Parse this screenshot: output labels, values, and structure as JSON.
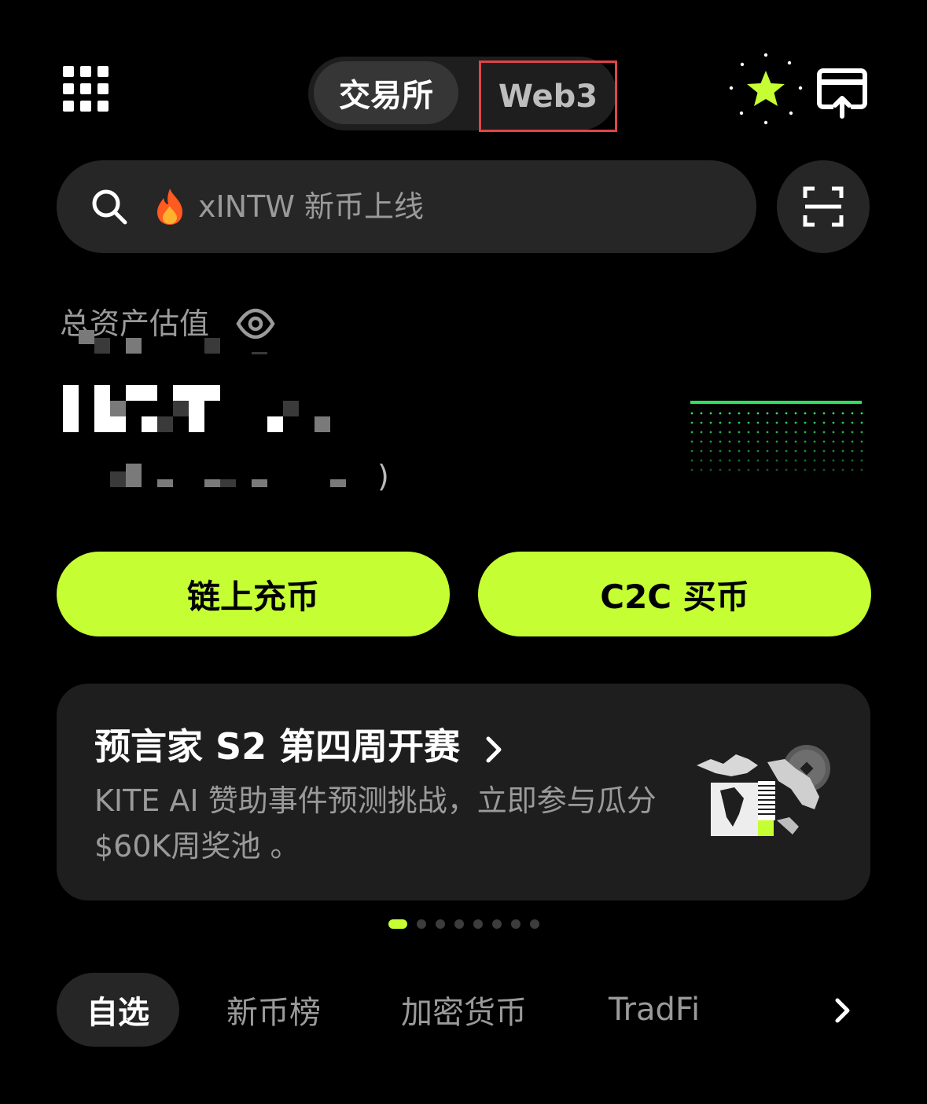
{
  "top_bar": {
    "mode_tabs": [
      {
        "label": "交易所",
        "active": true
      },
      {
        "label": "Web3",
        "active": false,
        "highlighted": true
      }
    ],
    "icons": [
      "grid-menu-icon",
      "star-icon",
      "share-card-icon"
    ],
    "accent_color": "#c5ff33",
    "highlight_border_color": "#e0444a"
  },
  "search": {
    "placeholder": "xINTW 新币上线",
    "leading_icons": [
      "search-icon",
      "fire-icon"
    ],
    "scan_icon": "scan-icon"
  },
  "assets": {
    "label": "总资产估值",
    "visibility_icon": "eye-icon",
    "value_obscured": true,
    "sub_value_suffix": ")"
  },
  "actions": [
    {
      "label": "链上充币"
    },
    {
      "label": "C2C 买币"
    }
  ],
  "banner": {
    "title": "预言家 S2 第四周开赛",
    "title_chevron": "chevron-right-icon",
    "description": "KITE AI 赞助事件预测挑战，立即参与瓜分$60K周奖池 。",
    "art_icon": "world-map-coin-illustration"
  },
  "carousel": {
    "total": 8,
    "active_index": 0
  },
  "bottom_tabs": [
    {
      "label": "自选",
      "active": true
    },
    {
      "label": "新币榜",
      "active": false
    },
    {
      "label": "加密货币",
      "active": false
    },
    {
      "label": "TradFi",
      "active": false
    }
  ],
  "bottom_tabs_more_icon": "chevron-right-icon"
}
